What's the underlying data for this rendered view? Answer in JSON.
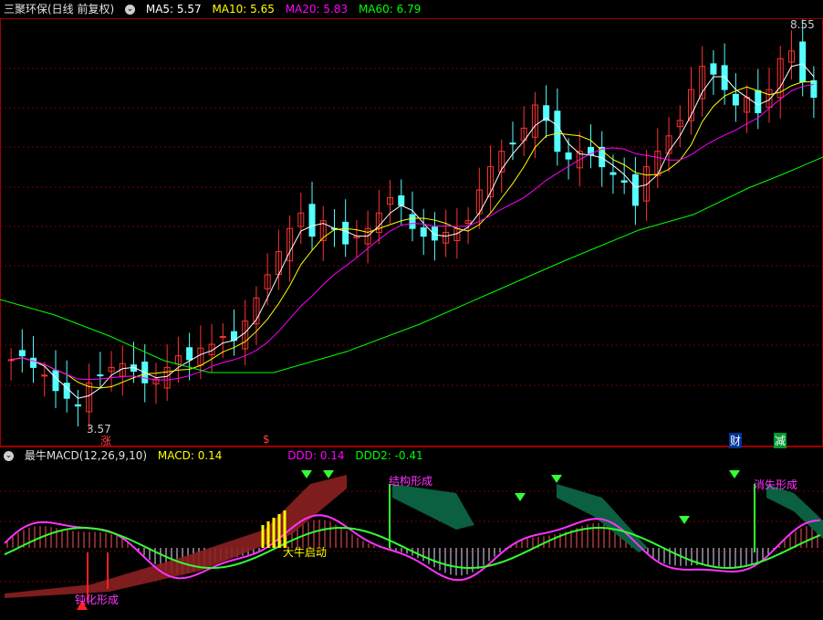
{
  "main_panel": {
    "stock_title": "三聚环保(日线 前复权)",
    "ma5": {
      "label": "MA5: 5.57",
      "color": "#ffffff"
    },
    "ma10": {
      "label": "MA10: 5.65",
      "color": "#ffff00"
    },
    "ma20": {
      "label": "MA20: 5.83",
      "color": "#ff00ff"
    },
    "ma60": {
      "label": "MA60: 6.79",
      "color": "#00ff00"
    },
    "high_label": "8.55",
    "low_label": "3.57",
    "event_markers": [
      "涨",
      "$",
      "财",
      "减"
    ]
  },
  "indicator_panel": {
    "title": "最牛MACD(12,26,9,10)",
    "macd": "MACD: 0.14",
    "ddd": "DDD: 0.14",
    "ddd2": "DDD2: -0.41",
    "annotations": [
      "结构形成",
      "大牛启动",
      "消失形成",
      "钝化形成"
    ]
  },
  "colors": {
    "up": "#ff3232",
    "down": "#54ffff",
    "grid": "#7a0000",
    "ma5": "#ffffff",
    "ma10": "#ffff00",
    "ma20": "#ff00ff",
    "ma60": "#00ff00"
  },
  "chart_data": {
    "type": "candlestick",
    "price_range": [
      3.57,
      8.55
    ],
    "close_points": [
      4.3,
      4.35,
      4.2,
      4.1,
      3.9,
      3.8,
      3.7,
      4.0,
      4.1,
      4.2,
      4.25,
      4.15,
      4.0,
      4.05,
      4.2,
      4.35,
      4.3,
      4.45,
      4.5,
      4.6,
      4.55,
      4.8,
      5.1,
      5.4,
      5.7,
      6.0,
      6.2,
      5.9,
      6.1,
      6.0,
      5.8,
      5.9,
      6.0,
      6.2,
      6.4,
      6.3,
      6.0,
      5.9,
      5.85,
      5.95,
      6.0,
      6.1,
      6.5,
      6.8,
      7.0,
      7.1,
      7.3,
      7.6,
      7.4,
      7.0,
      6.9,
      7.0,
      6.95,
      6.8,
      6.7,
      6.6,
      6.3,
      6.8,
      7.0,
      7.2,
      7.4,
      7.8,
      8.1,
      8.0,
      7.8,
      7.6,
      7.7,
      7.5,
      7.8,
      8.2,
      8.3,
      7.9,
      7.7
    ]
  }
}
